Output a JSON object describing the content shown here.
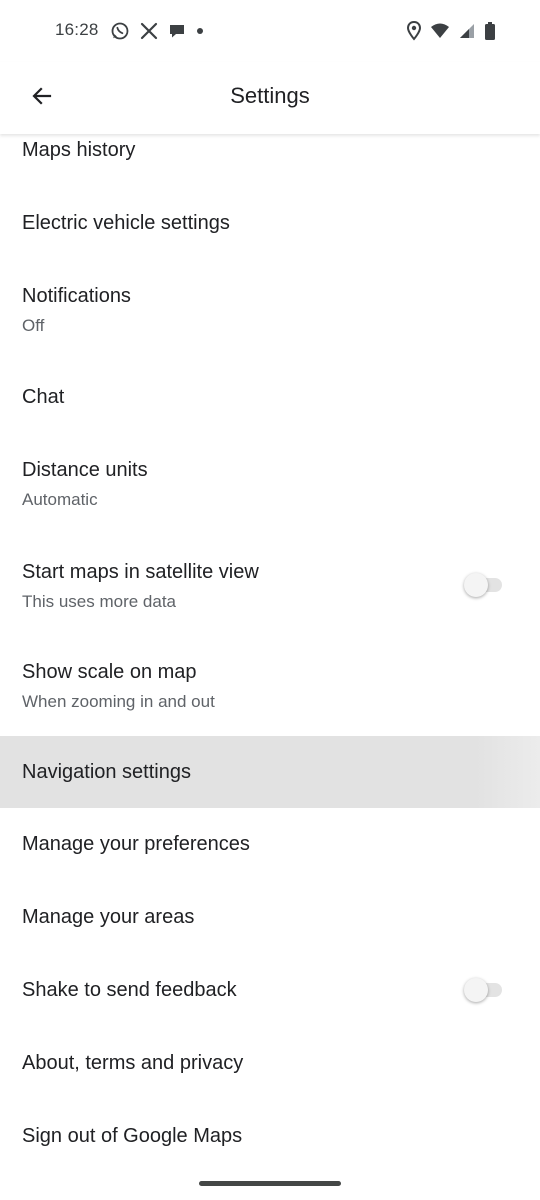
{
  "status_bar": {
    "time": "16:28",
    "left_icons": [
      "whatsapp-icon",
      "x-icon",
      "chat-bubble-icon",
      "dot-icon"
    ],
    "right_icons": [
      "location-icon",
      "wifi-icon",
      "signal-icon",
      "battery-icon"
    ]
  },
  "header": {
    "title": "Settings",
    "back_icon": "arrow-back-icon"
  },
  "settings": {
    "items": [
      {
        "title": "Maps history"
      },
      {
        "title": "Electric vehicle settings"
      },
      {
        "title": "Notifications",
        "subtitle": "Off"
      },
      {
        "title": "Chat"
      },
      {
        "title": "Distance units",
        "subtitle": "Automatic"
      },
      {
        "title": "Start maps in satellite view",
        "subtitle": "This uses more data",
        "toggle": false
      },
      {
        "title": "Show scale on map",
        "subtitle": "When zooming in and out"
      },
      {
        "title": "Navigation settings",
        "highlighted": true
      },
      {
        "title": "Manage your preferences"
      },
      {
        "title": "Manage your areas"
      },
      {
        "title": "Shake to send feedback",
        "toggle": false
      },
      {
        "title": "About, terms and privacy"
      },
      {
        "title": "Sign out of Google Maps"
      }
    ]
  },
  "colors": {
    "text_primary": "#202124",
    "text_secondary": "#5f6368",
    "highlight": "#e2e2e2",
    "toggle_off_track": "#e3e3e3"
  }
}
